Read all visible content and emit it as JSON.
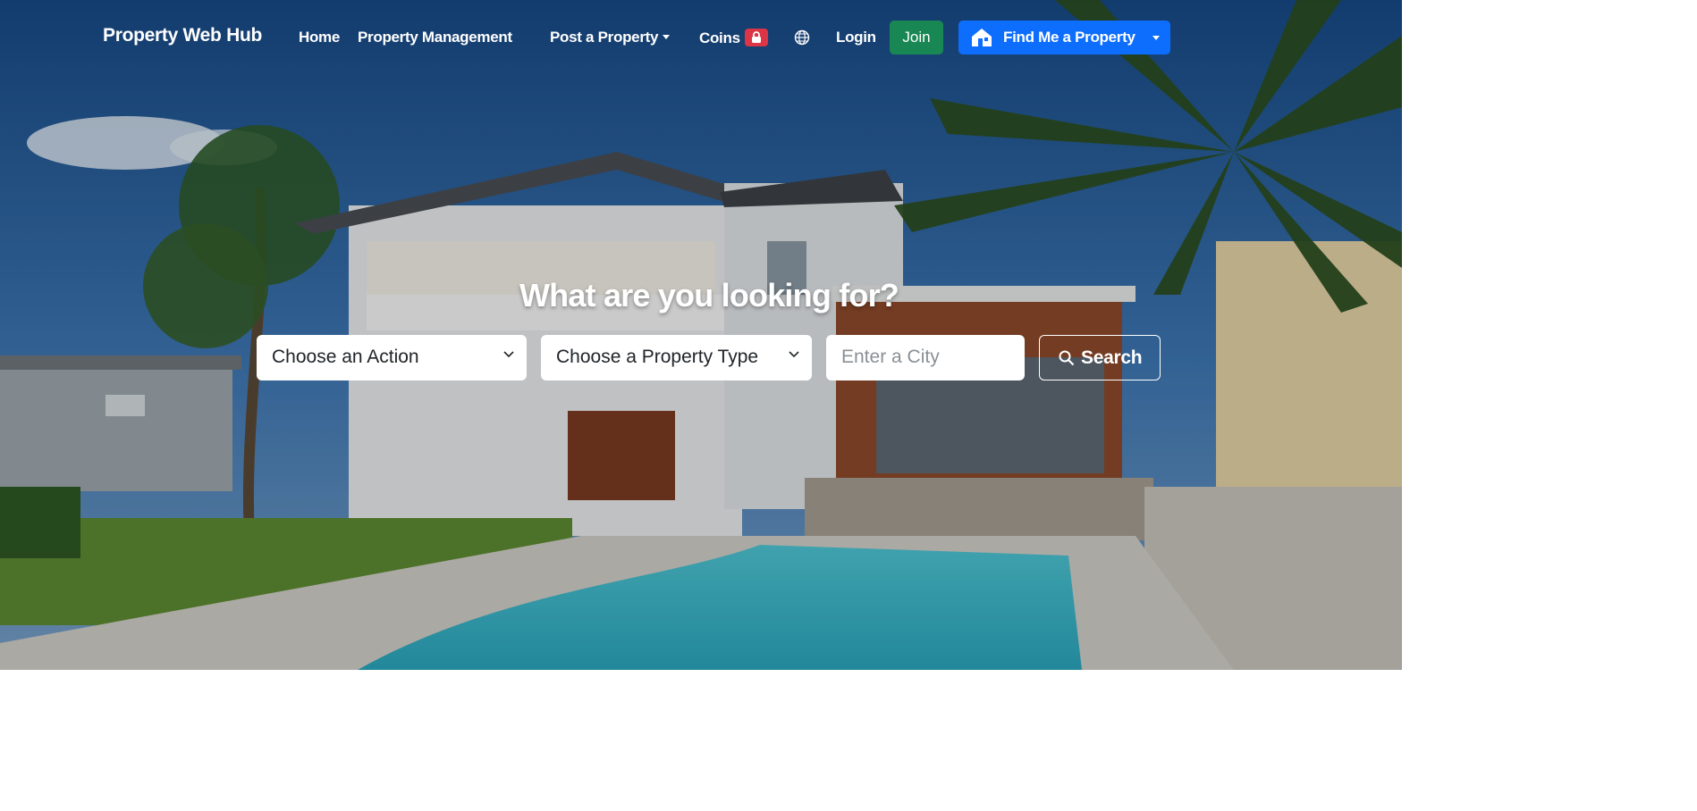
{
  "nav": {
    "brand": "Property Web Hub",
    "home": "Home",
    "property_management": "Property Management",
    "post_property": "Post a Property",
    "coins": "Coins",
    "login": "Login",
    "join": "Join",
    "find_me": "Find Me a Property"
  },
  "hero": {
    "headline": "What are you looking for?",
    "action_select": "Choose an Action",
    "type_select": "Choose a Property Type",
    "city_placeholder": "Enter a City",
    "search_label": "Search"
  },
  "colors": {
    "join_green": "#198754",
    "find_blue": "#0d6efd",
    "coins_badge_red": "#dc3545"
  },
  "icons": [
    "lock-icon",
    "globe-icon",
    "house-icon",
    "search-icon",
    "chevron-down-icon"
  ]
}
